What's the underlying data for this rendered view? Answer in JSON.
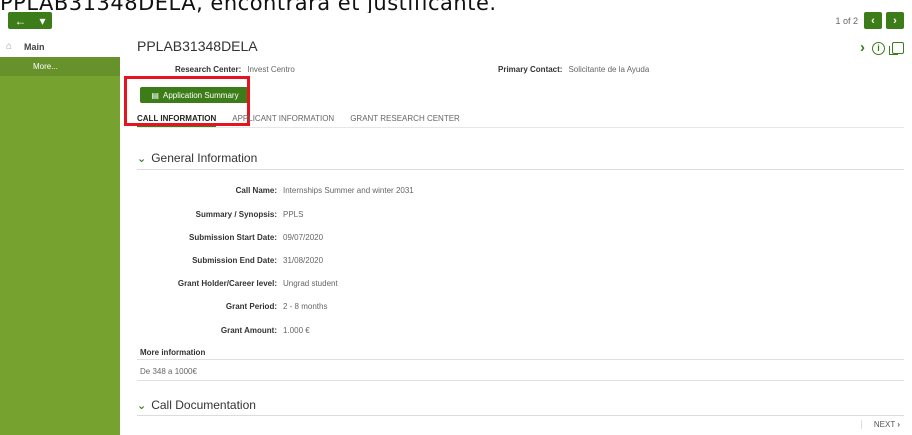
{
  "caption": "PPLAB31348DELA, encontrará et justificante.",
  "toolbar": {
    "back_icon": "←",
    "dropdown_icon": "▾",
    "pager_count": "1 of 2",
    "prev_icon": "‹",
    "next_icon": "›"
  },
  "sidebar": {
    "main_label": "Main",
    "more_label": "More...",
    "colors": {
      "sidebar_green": "#76a22f",
      "active_green": "#67912a"
    }
  },
  "record": {
    "title": "PPLAB31348DELA",
    "research_center_label": "Research Center:",
    "research_center_value": "Invest Centro",
    "primary_contact_label": "Primary Contact:",
    "primary_contact_value": "Solicitante de la Ayuda",
    "app_summary_label": "Application Summary"
  },
  "tabs": [
    {
      "label": "CALL INFORMATION",
      "active": true
    },
    {
      "label": "APPLICANT INFORMATION",
      "active": false
    },
    {
      "label": "GRANT RESEARCH CENTER",
      "active": false
    }
  ],
  "general_info": {
    "heading": "General Information",
    "fields": [
      {
        "label": "Call Name:",
        "value": "Internships Summer and winter 2031"
      },
      {
        "label": "Summary / Synopsis:",
        "value": "PPLS"
      },
      {
        "label": "Submission Start Date:",
        "value": "09/07/2020"
      },
      {
        "label": "Submission End Date:",
        "value": "31/08/2020"
      },
      {
        "label": "Grant Holder/Career level:",
        "value": "Ungrad student"
      },
      {
        "label": "Grant Period:",
        "value": "2 - 8 months"
      },
      {
        "label": "Grant Amount:",
        "value": "1.000 €"
      }
    ],
    "more_info_label": "More information",
    "more_info_value": "De 348 a 1000€"
  },
  "call_documentation": {
    "heading": "Call Documentation"
  },
  "next_label": "NEXT",
  "colors": {
    "accent": "#3d7d19",
    "highlight": "#e6141e"
  }
}
